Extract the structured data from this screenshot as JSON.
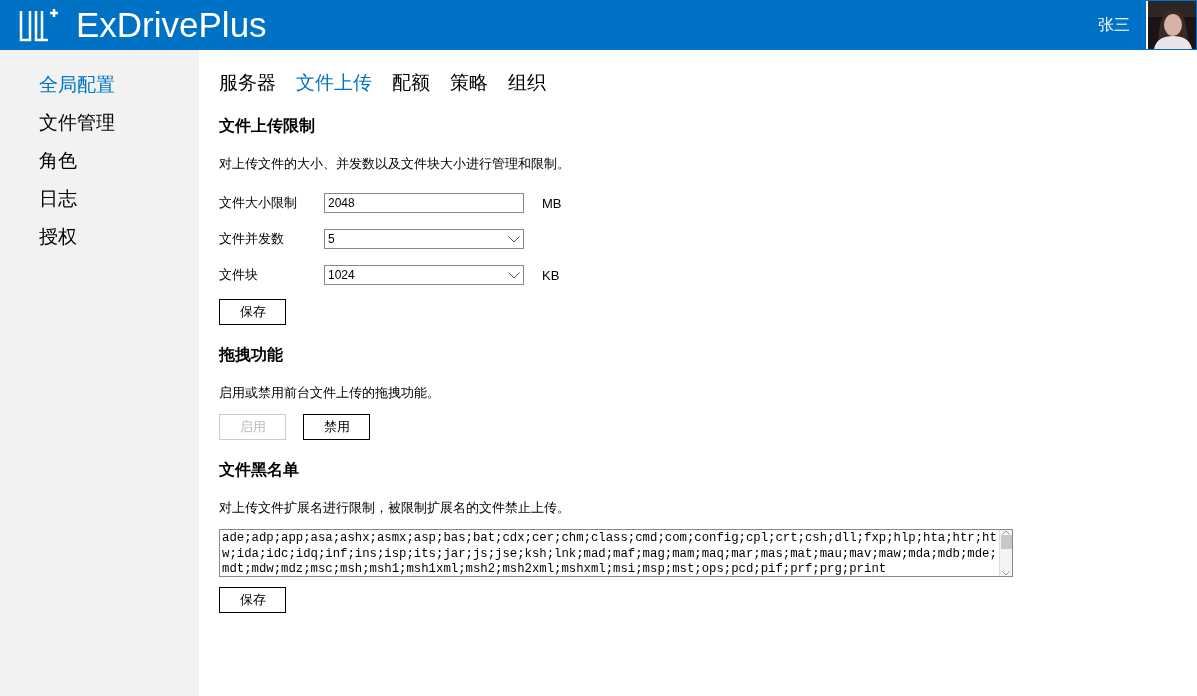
{
  "header": {
    "app_name": "ExDrivePlus",
    "user_name": "张三"
  },
  "sidebar": {
    "items": [
      {
        "label": "全局配置",
        "selected": true
      },
      {
        "label": "文件管理",
        "selected": false
      },
      {
        "label": "角色",
        "selected": false
      },
      {
        "label": "日志",
        "selected": false
      },
      {
        "label": "授权",
        "selected": false
      }
    ]
  },
  "tabs": [
    {
      "label": "服务器",
      "selected": false
    },
    {
      "label": "文件上传",
      "selected": true
    },
    {
      "label": "配额",
      "selected": false
    },
    {
      "label": "策略",
      "selected": false
    },
    {
      "label": "组织",
      "selected": false
    }
  ],
  "sections": [
    {
      "title": "文件上传限制",
      "description": "对上传文件的大小、并发数以及文件块大小进行管理和限制。",
      "fields": [
        {
          "kind": "text",
          "label": "文件大小限制",
          "value": "2048",
          "unit": "MB"
        },
        {
          "kind": "select",
          "label": "文件并发数",
          "value": "5"
        },
        {
          "kind": "select",
          "label": "文件块",
          "value": "1024",
          "unit": "KB"
        }
      ],
      "buttons": [
        {
          "label": "保存",
          "disabled": false
        }
      ]
    },
    {
      "title": "拖拽功能",
      "description": "启用或禁用前台文件上传的拖拽功能。",
      "buttons": [
        {
          "label": "启用",
          "disabled": true
        },
        {
          "label": "禁用",
          "disabled": false
        }
      ]
    },
    {
      "title": "文件黑名单",
      "description": "对上传文件扩展名进行限制，被限制扩展名的文件禁止上传。",
      "textarea": "ade;adp;app;asa;ashx;asmx;asp;bas;bat;cdx;cer;chm;class;cmd;com;config;cpl;crt;csh;dll;fxp;hlp;hta;htr;htw;ida;idc;idq;inf;ins;isp;its;jar;js;jse;ksh;lnk;mad;maf;mag;mam;maq;mar;mas;mat;mau;mav;maw;mda;mdb;mde;mdt;mdw;mdz;msc;msh;msh1;msh1xml;msh2;msh2xml;mshxml;msi;msp;mst;ops;pcd;pif;prf;prg;print",
      "buttons": [
        {
          "label": "保存",
          "disabled": false
        }
      ]
    }
  ]
}
